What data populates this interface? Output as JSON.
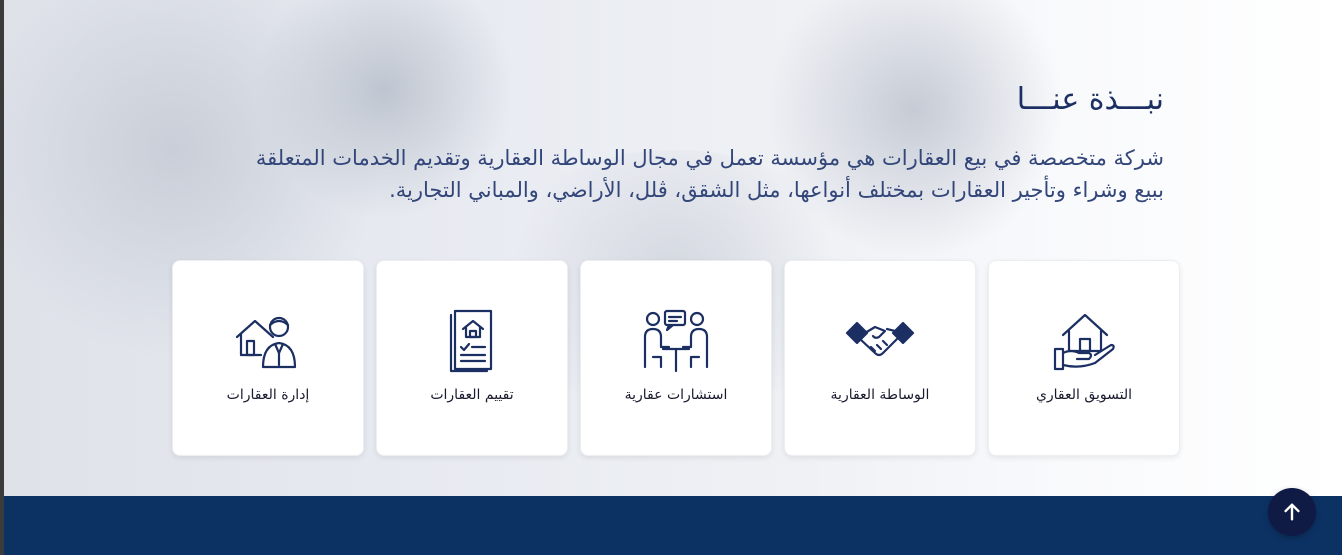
{
  "about": {
    "title": "نبـــذة عنـــا",
    "description": "شركة متخصصة في بيع العقارات هي مؤسسة تعمل في مجال الوساطة العقارية وتقديم الخدمات المتعلقة ببيع وشراء وتأجير العقارات بمختلف أنواعها، مثل الشقق، ڤلل، الأراضي، والمباني التجارية."
  },
  "services": [
    {
      "label": "التسويق العقاري",
      "icon": "house-in-hand-icon"
    },
    {
      "label": "الوساطة العقارية",
      "icon": "handshake-icon"
    },
    {
      "label": "استشارات عقارية",
      "icon": "consultation-icon"
    },
    {
      "label": "تقييم العقارات",
      "icon": "property-document-icon"
    },
    {
      "label": "إدارة العقارات",
      "icon": "property-manager-icon"
    }
  ],
  "colors": {
    "accent": "#1c2f63",
    "footer": "#0c3264",
    "scroll_button": "#0f1a45"
  }
}
